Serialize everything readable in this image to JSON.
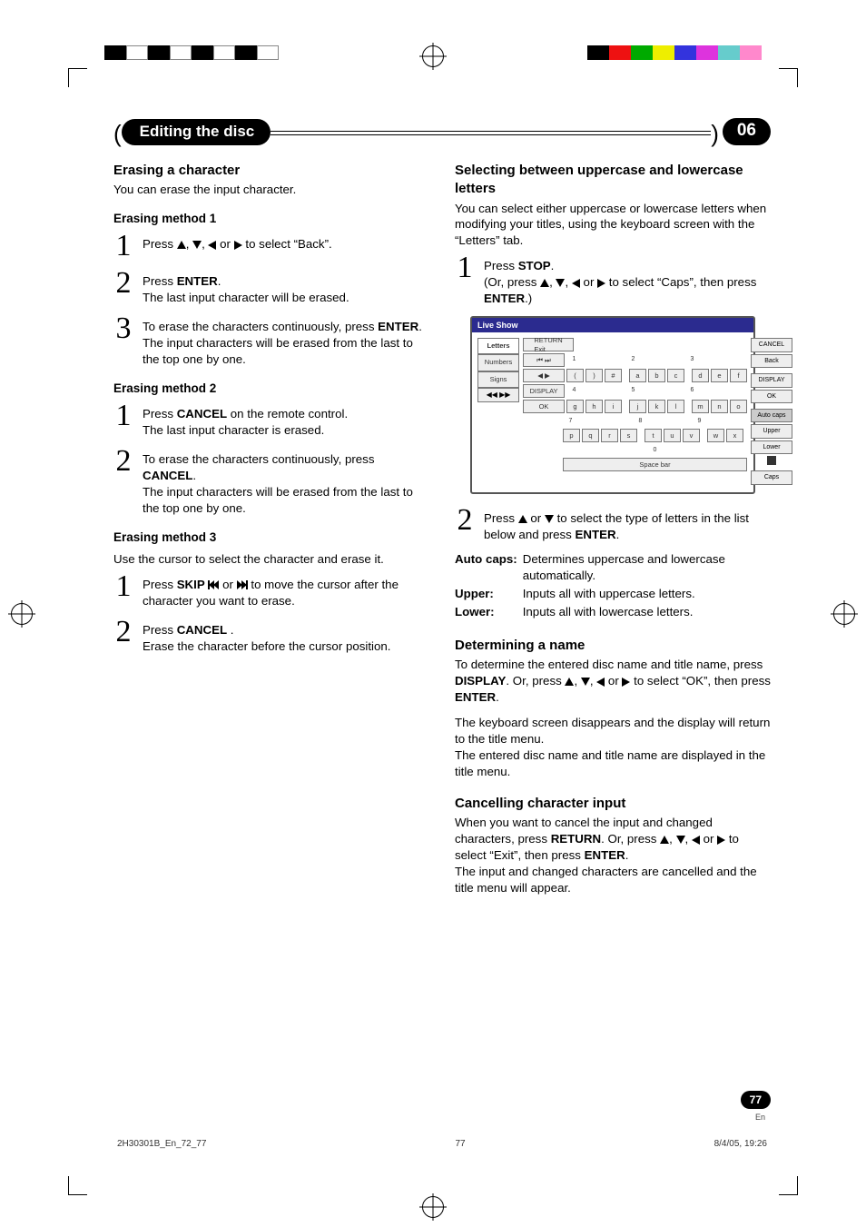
{
  "header": {
    "title": "Editing the disc",
    "chapter": "06"
  },
  "left": {
    "h_erase_char": "Erasing a character",
    "erase_intro": "You can erase the input character.",
    "m1_title": "Erasing method 1",
    "m1_s1": "Press ▲, ▼, ◀ or ▶ to select “Back”.",
    "m1_s2a": "Press ",
    "m1_s2b": "ENTER",
    "m1_s2c": ".",
    "m1_s2d": "The last input character will be erased.",
    "m1_s3a": "To erase the characters continuously, press ",
    "m1_s3b": "ENTER",
    "m1_s3c": ".",
    "m1_s3d": "The input characters will be erased from the last to the top one by one.",
    "m2_title": "Erasing method 2",
    "m2_s1a": "Press ",
    "m2_s1b": "CANCEL",
    "m2_s1c": " on the remote control.",
    "m2_s1d": "The last input character is erased.",
    "m2_s2a": "To erase the characters continuously, press ",
    "m2_s2b": "CANCEL",
    "m2_s2c": ".",
    "m2_s2d": "The input characters will be erased from the last to the top one by one.",
    "m3_title": "Erasing method 3",
    "m3_intro": "Use the cursor to select the character and erase it.",
    "m3_s1a": "Press ",
    "m3_s1b": "SKIP",
    "m3_s1c": " or ",
    "m3_s1d": " to move the cursor after the character you want to erase.",
    "m3_s2a": "Press ",
    "m3_s2b": "CANCEL",
    "m3_s2c": " .",
    "m3_s2d": "Erase the character before the cursor position."
  },
  "right": {
    "h_case": "Selecting between uppercase and lowercase letters",
    "case_intro": "You can select either uppercase or lowercase letters when modifying your titles, using the keyboard screen with the “Letters” tab.",
    "s1a": "Press ",
    "s1b": "STOP",
    "s1c": ".",
    "s1d_a": "(Or, press ",
    "s1d_b": " to select “Caps”, then press ",
    "s1d_c": "ENTER",
    "s1d_d": ".)",
    "s2a": "Press ",
    "s2b": " or ",
    "s2c": " to select the type of letters in the list below and press ",
    "s2d": "ENTER",
    "s2e": ".",
    "defs": {
      "autocaps_k": "Auto caps",
      "autocaps_v": "Determines uppercase and lowercase automatically.",
      "upper_k": "Upper",
      "upper_v": "Inputs all with uppercase letters.",
      "lower_k": "Lower",
      "lower_v": "Inputs all with lowercase letters."
    },
    "h_det": "Determining a name",
    "det_p1a": "To determine the entered disc name and title name, press ",
    "det_p1b": "DISPLAY",
    "det_p1c": ". Or, press ",
    "det_p1d": " to select “OK”, then press ",
    "det_p1e": "ENTER",
    "det_p1f": ".",
    "det_p2": "The keyboard screen disappears and the display will return to the title menu.",
    "det_p3": "The entered disc name and title name are displayed in the title menu.",
    "h_cancel": "Cancelling character input",
    "can_p1a": "When you want to cancel the input and changed characters, press ",
    "can_p1b": "RETURN",
    "can_p1c": ". Or, press ",
    "can_p1d": " or ",
    "can_p1e": " to select “Exit”, then press ",
    "can_p1f": "ENTER",
    "can_p1g": ".",
    "can_p2": "The input and changed characters are cancelled and the title menu will appear."
  },
  "keyboard": {
    "title": "Live Show",
    "tabs": [
      "Letters",
      "Numbers",
      "Signs"
    ],
    "nav_prev": "⏮ ⏭",
    "nav_lr": "◀  ▶",
    "nav_ff": "◀◀  ▶▶",
    "rows": [
      {
        "hdr": "RETURN Exit"
      },
      {
        "num": "1",
        "keys": [
          "(",
          ")",
          "#"
        ],
        "num2": "2",
        "keys2": [
          "a",
          "b",
          "c"
        ],
        "num3": "3",
        "keys3": [
          "d",
          "e",
          "f"
        ],
        "right": "CANCEL"
      },
      {
        "rightb": "Back"
      },
      {
        "left": "DISPLAY",
        "num": "4",
        "keys": [
          "g",
          "h",
          "i"
        ],
        "num2": "5",
        "keys2": [
          "j",
          "k",
          "l"
        ],
        "num3": "6",
        "keys3": [
          "m",
          "n",
          "o"
        ],
        "right": "DISPLAY"
      },
      {
        "left": "OK",
        "right": "OK"
      },
      {
        "num": "7",
        "keys": [
          "p",
          "q",
          "r",
          "s"
        ],
        "num2": "8",
        "keys2": [
          "t",
          "u",
          "v"
        ],
        "num3": "9",
        "keys3": [
          "w",
          "x"
        ],
        "right": "Auto caps"
      },
      {
        "right": "Upper"
      },
      {
        "num": "0",
        "space": "Space bar",
        "right": "Lower"
      },
      {
        "right": "Caps",
        "sq": true
      }
    ]
  },
  "page": {
    "num": "77",
    "lang": "En"
  },
  "footer": {
    "left": "2H30301B_En_72_77",
    "center": "77",
    "right": "8/4/05, 19:26"
  },
  "chart_data": null
}
